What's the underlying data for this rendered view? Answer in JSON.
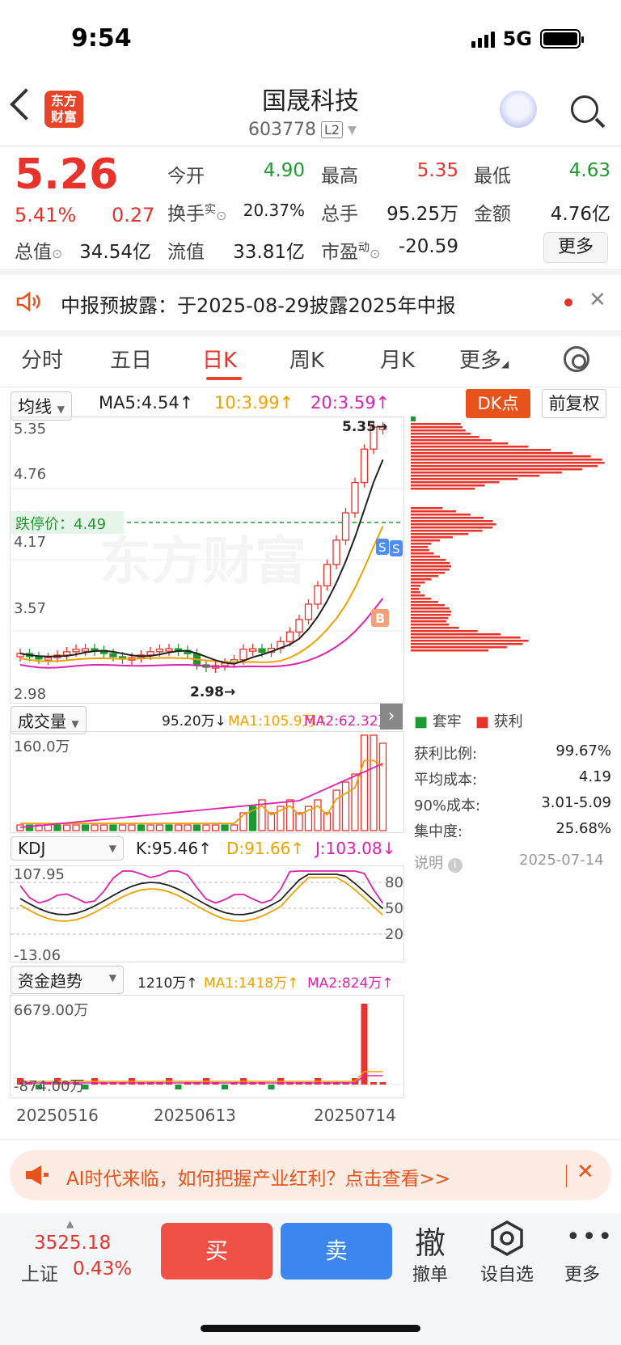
{
  "status": {
    "time": "9:54",
    "network": "5G"
  },
  "header": {
    "logo_text_1": "东方",
    "logo_text_2": "财富",
    "stock_name": "国晟科技",
    "stock_code": "603778",
    "level": "L2"
  },
  "quote": {
    "price": "5.26",
    "change_pct": "5.41%",
    "change": "0.27",
    "open_label": "今开",
    "open": "4.90",
    "high_label": "最高",
    "high": "5.35",
    "low_label": "最低",
    "low": "4.63",
    "turnover_label": "换手",
    "turnover_sup": "实",
    "turnover": "20.37%",
    "volume_label": "总手",
    "volume": "95.25万",
    "amount_label": "金额",
    "amount": "4.76亿",
    "mktcap_label": "总值",
    "mktcap": "34.54亿",
    "float_label": "流值",
    "float": "33.81亿",
    "pe_label": "市盈",
    "pe_sup": "动",
    "pe": "-20.59",
    "more_label": "更多"
  },
  "notice": {
    "text": "中报预披露：于2025-08-29披露2025年中报"
  },
  "tabs": [
    "分时",
    "五日",
    "日K",
    "周K",
    "月K",
    "更多"
  ],
  "active_tab": "日K",
  "ma_row": {
    "selector": "均线",
    "ma5": "MA5:4.54↑",
    "ma10": "10:3.99↑",
    "ma20": "20:3.59↑",
    "dk_label": "DK点",
    "fq_label": "前复权"
  },
  "kline": {
    "y_labels": [
      "5.35",
      "4.76",
      "4.17",
      "3.57",
      "2.98"
    ],
    "limit_down_label": "跌停价：4.49",
    "high_marker": "5.35→",
    "low_marker": "2.98→",
    "watermark": "东方财富"
  },
  "volume_row": {
    "selector": "成交量",
    "value": "95.20万↓",
    "ma1": "MA1:105.9万↑",
    "ma2": "MA2:62.32万↑",
    "y_top": "160.0万"
  },
  "kdj_row": {
    "selector": "KDJ",
    "k": "K:95.46↑",
    "d": "D:91.66↑",
    "j": "J:103.08↓",
    "y_top": "107.95",
    "y_bottom": "-13.06",
    "levels": [
      "80",
      "50",
      "20"
    ]
  },
  "fund_row": {
    "selector": "资金趋势",
    "value": "1210万↑",
    "ma1": "MA1:1418万↑",
    "ma2": "MA2:824万↑",
    "y_top": "6679.00万",
    "y_bottom": "-874.00万",
    "dates": [
      "20250516",
      "20250613",
      "20250714"
    ]
  },
  "chips": {
    "legend_trapped": "套牢",
    "legend_profit": "获利",
    "rows": [
      {
        "label": "获利比例:",
        "value": "99.67%"
      },
      {
        "label": "平均成本:",
        "value": "4.19"
      },
      {
        "label": "90%成本:",
        "value": "3.01-5.09"
      },
      {
        "label": "集中度:",
        "value": "25.68%"
      }
    ],
    "note_label": "说明",
    "date": "2025-07-14"
  },
  "ad": {
    "text": "AI时代来临，如何把握产业红利？点击查看>>"
  },
  "bottom": {
    "index_value": "3525.18",
    "index_name": "上证",
    "index_pct": "0.43%",
    "buy": "买",
    "sell": "卖",
    "cancel_icon": "撤",
    "cancel": "撤单",
    "watchlist": "设自选",
    "more": "更多"
  }
}
